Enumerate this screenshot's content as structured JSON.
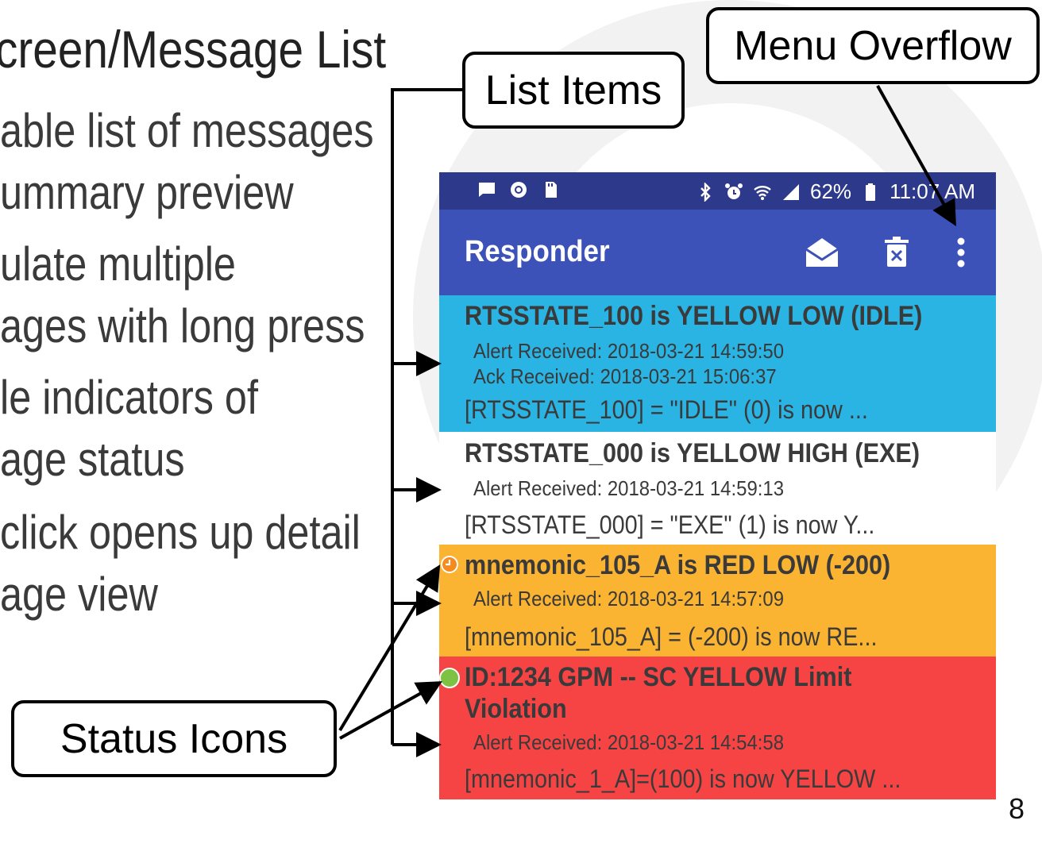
{
  "slide": {
    "title": "creen/Message List",
    "bullets": [
      "able list of messages",
      "ummary preview",
      "ulate multiple",
      "ages with long press",
      "le indicators of",
      "age status",
      " click opens up detail",
      "age view"
    ],
    "page_number": "8"
  },
  "callouts": {
    "list_items": "List Items",
    "menu_overflow": "Menu Overflow",
    "status_icons": "Status Icons"
  },
  "phone": {
    "status_bar": {
      "left_icons": [
        "chat-icon",
        "eye-icon",
        "sd-card-icon"
      ],
      "right_icons": [
        "bluetooth-icon",
        "alarm-icon",
        "wifi-icon",
        "signal-icon",
        "battery-icon"
      ],
      "battery": "62%",
      "time": "11:07 AM"
    },
    "app_bar": {
      "title": "Responder",
      "actions": [
        "mark-read-icon",
        "delete-icon",
        "overflow-menu-icon"
      ]
    },
    "messages": [
      {
        "title": "RTSSTATE_100 is YELLOW LOW (IDLE)",
        "meta": [
          "Alert Received: 2018-03-21 14:59:50",
          "Ack Received: 2018-03-21 15:06:37"
        ],
        "preview": "[RTSSTATE_100] = \"IDLE\" (0) is now ...",
        "background": "#2ab4e4",
        "status_icon": ""
      },
      {
        "title": "RTSSTATE_000 is YELLOW HIGH (EXE)",
        "meta": [
          "Alert Received: 2018-03-21 14:59:13"
        ],
        "preview": "[RTSSTATE_000] = \"EXE\" (1) is now Y...",
        "background": "#ffffff",
        "status_icon": ""
      },
      {
        "title": "mnemonic_105_A is RED LOW (-200)",
        "meta": [
          "Alert Received: 2018-03-21 14:57:09"
        ],
        "preview": "[mnemonic_105_A] = (-200) is now RE...",
        "background": "#fbb332",
        "status_icon": "clock-icon"
      },
      {
        "title": "ID:1234 GPM -- SC YELLOW Limit",
        "title_line2": "Violation",
        "meta": [
          "Alert Received: 2018-03-21 14:54:58"
        ],
        "preview": "[mnemonic_1_A]=(100) is now YELLOW ...",
        "background": "#f64444",
        "status_icon": "green-dot-icon"
      }
    ]
  },
  "colors": {
    "status_bar": "#2d3a8c",
    "app_bar": "#3d52b8",
    "clock_icon": "#f58a1f",
    "green_dot": "#7dc242"
  }
}
